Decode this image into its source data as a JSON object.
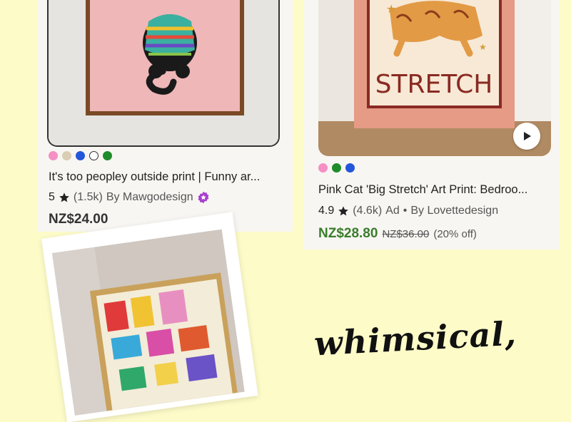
{
  "products": [
    {
      "swatch_colors": [
        "#f58fc4",
        "#d9cdb3",
        "#2357d9",
        "#ffffff",
        "#1f8c2b"
      ],
      "title": "It's too peopley outside print | Funny ar...",
      "rating": "5",
      "reviews": "(1.5k)",
      "seller": "By Mawgodesign",
      "price": "NZ$24.00"
    },
    {
      "swatch_colors": [
        "#f58fc4",
        "#1f8c2b",
        "#2357d9"
      ],
      "title": "Pink Cat 'Big Stretch' Art Print: Bedroo...",
      "rating": "4.9",
      "reviews": "(4.6k)",
      "ad": "Ad",
      "separator": "•",
      "seller": "By Lovettedesign",
      "price": "NZ$28.80",
      "original_price": "NZ$36.00",
      "discount": "(20% off)",
      "poster_text": "STRETCH"
    }
  ],
  "caption": "whimsical,",
  "colors": {
    "background": "#fdfbc8",
    "sale_price": "#3a7d2c",
    "star_seller_badge": "#a83fcf"
  }
}
